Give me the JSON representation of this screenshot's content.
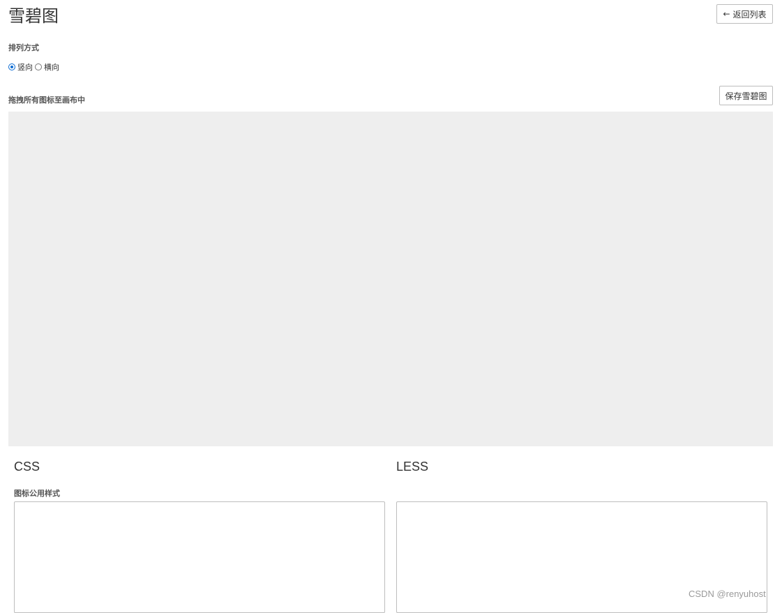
{
  "header": {
    "title": "雪碧图",
    "back_button_label": "返回列表"
  },
  "sort": {
    "label": "排列方式",
    "options": [
      {
        "label": "竖向",
        "checked": true
      },
      {
        "label": "横向",
        "checked": false
      }
    ]
  },
  "canvas": {
    "label": "拖拽所有图标至画布中",
    "save_button_label": "保存雪碧图"
  },
  "output": {
    "css_title": "CSS",
    "less_title": "LESS",
    "common_style_label": "图标公用样式",
    "css_value": "",
    "less_value": ""
  },
  "watermark": "CSDN @renyuhost",
  "colors": {
    "canvas_bg": "#eeeeee",
    "radio_accent": "#0b6bd3"
  }
}
